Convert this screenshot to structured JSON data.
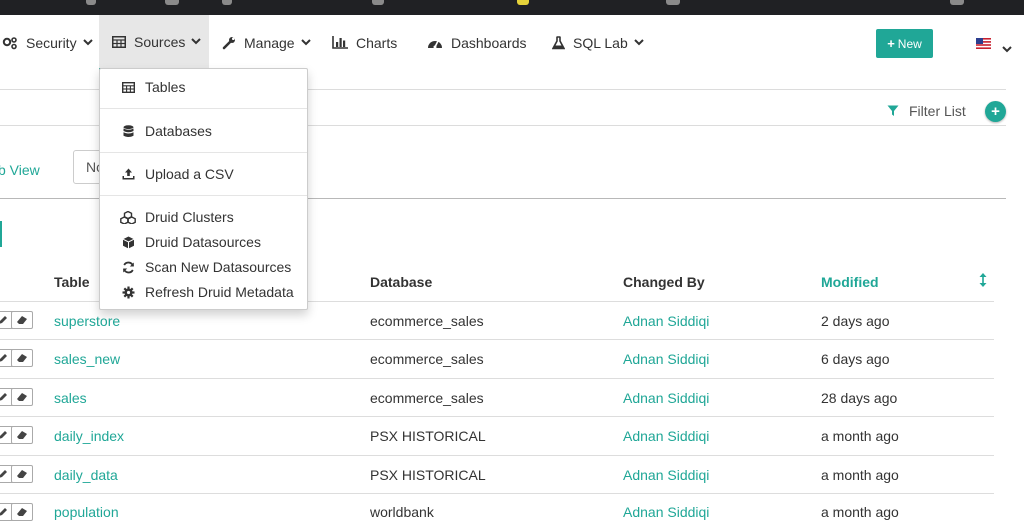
{
  "nav": {
    "items": [
      {
        "label": "Security",
        "icon": "gears-icon",
        "has_caret": true
      },
      {
        "label": "Sources",
        "icon": "table-icon",
        "has_caret": true,
        "active": true
      },
      {
        "label": "Manage",
        "icon": "wrench-icon",
        "has_caret": true
      },
      {
        "label": "Charts",
        "icon": "bar-chart-icon",
        "has_caret": false
      },
      {
        "label": "Dashboards",
        "icon": "dashboard-icon",
        "has_caret": false
      },
      {
        "label": "SQL Lab",
        "icon": "flask-icon",
        "has_caret": true
      }
    ],
    "new_button": "New",
    "locale_flag": "us-flag-icon"
  },
  "sources_menu": {
    "items": [
      {
        "label": "Tables",
        "icon": "table-icon"
      },
      {
        "label": "Databases",
        "icon": "database-icon"
      },
      {
        "label": "Upload a CSV",
        "icon": "upload-icon"
      },
      {
        "label": "Druid Clusters",
        "icon": "cubes-icon"
      },
      {
        "label": "Druid Datasources",
        "icon": "cube-icon"
      },
      {
        "label": "Scan New Datasources",
        "icon": "refresh-icon"
      },
      {
        "label": "Refresh Druid Metadata",
        "icon": "cog-icon"
      }
    ]
  },
  "toolbar": {
    "filter_label": "Filter List",
    "view_link": "b View",
    "select_value": "No"
  },
  "table": {
    "columns": [
      "Table",
      "Database",
      "Changed By",
      "Modified"
    ],
    "sorted_column": "Modified",
    "rows": [
      {
        "table": "superstore",
        "database": "ecommerce_sales",
        "changed_by": "Adnan Siddiqi",
        "modified": "2 days ago"
      },
      {
        "table": "sales_new",
        "database": "ecommerce_sales",
        "changed_by": "Adnan Siddiqi",
        "modified": "6 days ago"
      },
      {
        "table": "sales",
        "database": "ecommerce_sales",
        "changed_by": "Adnan Siddiqi",
        "modified": "28 days ago"
      },
      {
        "table": "daily_index",
        "database": "PSX HISTORICAL",
        "changed_by": "Adnan Siddiqi",
        "modified": "a month ago"
      },
      {
        "table": "daily_data",
        "database": "PSX HISTORICAL",
        "changed_by": "Adnan Siddiqi",
        "modified": "a month ago"
      },
      {
        "table": "population",
        "database": "worldbank",
        "changed_by": "Adnan Siddiqi",
        "modified": "a month ago"
      }
    ]
  },
  "colors": {
    "accent": "#20a797",
    "active_tab_bg": "#e7e7e7",
    "topstrip": "#202124"
  }
}
